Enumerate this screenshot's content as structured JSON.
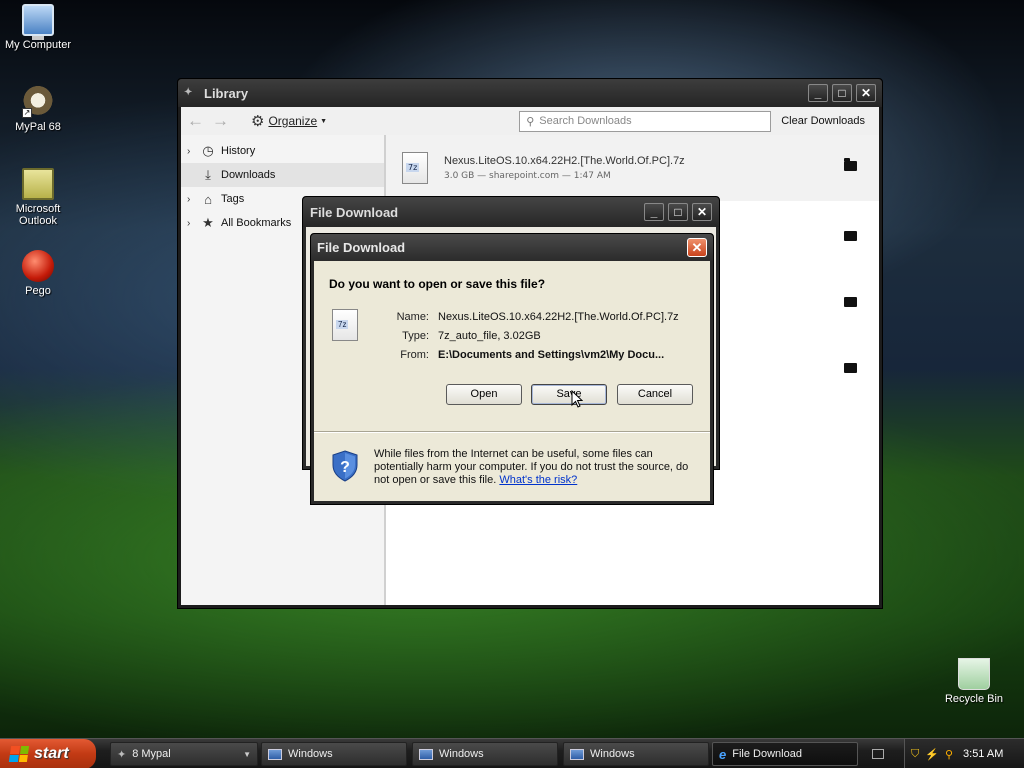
{
  "desktop": {
    "icons": [
      {
        "label": "My Computer"
      },
      {
        "label": "MyPal 68"
      },
      {
        "label": "Microsoft Outlook"
      },
      {
        "label": "Pego"
      },
      {
        "label": "Recycle Bin"
      }
    ]
  },
  "library": {
    "title": "Library",
    "toolbar": {
      "organize_label": "Organize",
      "search_placeholder": "Search Downloads",
      "clear_label": "Clear Downloads"
    },
    "sidebar": {
      "items": [
        {
          "label": "History"
        },
        {
          "label": "Downloads"
        },
        {
          "label": "Tags"
        },
        {
          "label": "All Bookmarks"
        }
      ]
    },
    "downloads": [
      {
        "name": "Nexus.LiteOS.10.x64.22H2.[The.World.Of.PC].7z",
        "meta": "3.0 GB — sharepoint.com — 1:47 AM"
      }
    ]
  },
  "file_download_outer": {
    "title": "File Download"
  },
  "file_download": {
    "title": "File Download",
    "question": "Do you want to open or save this file?",
    "name_label": "Name:",
    "name_value": "Nexus.LiteOS.10.x64.22H2.[The.World.Of.PC].7z",
    "type_label": "Type:",
    "type_value": "7z_auto_file, 3.02GB",
    "from_label": "From:",
    "from_value": "E:\\Documents and Settings\\vm2\\My Docu...",
    "open_label": "Open",
    "save_label": "Save",
    "cancel_label": "Cancel",
    "warning_text": "While files from the Internet can be useful, some files can potentially harm your computer. If you do not trust the source, do not open or save this file.",
    "warning_link": "What's the risk?"
  },
  "taskbar": {
    "start_label": "start",
    "tasks": [
      {
        "label": "8 Mypal"
      },
      {
        "label": "Windows"
      },
      {
        "label": "Windows"
      },
      {
        "label": "Windows"
      },
      {
        "label": "File Download"
      }
    ],
    "clock": "3:51 AM"
  }
}
